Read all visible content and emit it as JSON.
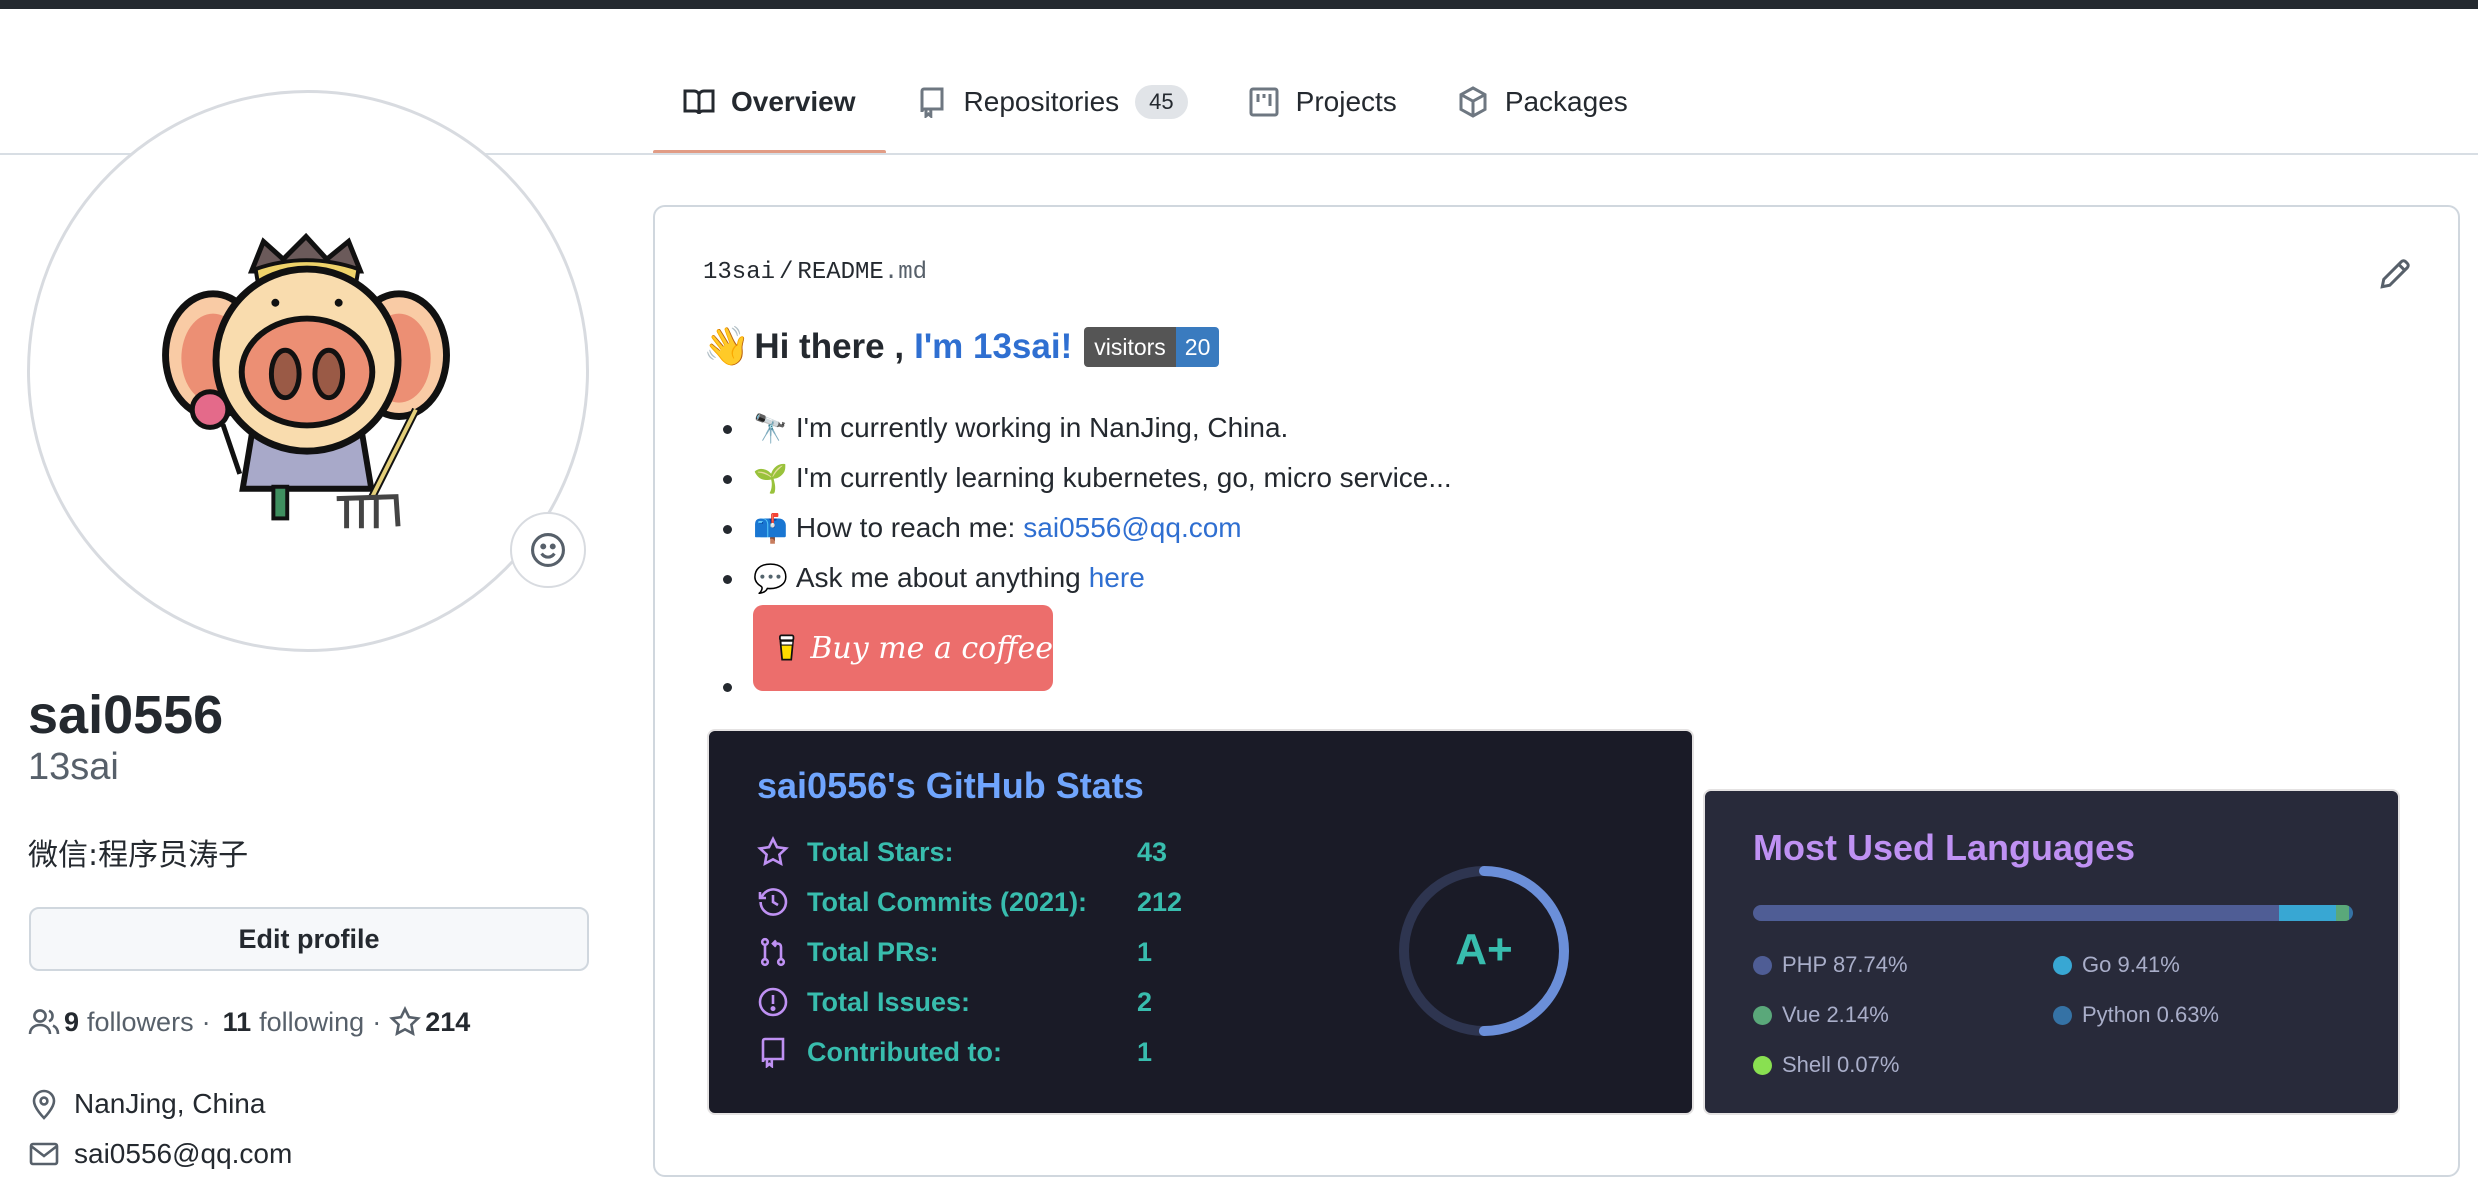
{
  "tabs": [
    {
      "label": "Overview",
      "icon": "book-icon",
      "active": true
    },
    {
      "label": "Repositories",
      "icon": "repo-icon",
      "count": "45"
    },
    {
      "label": "Projects",
      "icon": "project-icon"
    },
    {
      "label": "Packages",
      "icon": "package-icon"
    }
  ],
  "profile": {
    "login": "sai0556",
    "name": "13sai",
    "bio": "微信:程序员涛子",
    "edit_label": "Edit profile",
    "followers_count": "9",
    "followers_label": "followers",
    "following_count": "11",
    "following_label": "following",
    "stars_count": "214",
    "separator": "·",
    "location": "NanJing, China",
    "email": "sai0556@qq.com"
  },
  "readme": {
    "path_owner": "13sai",
    "path_sep": "/",
    "path_file": "README",
    "path_ext": ".md",
    "heading_emoji": "👋",
    "heading_text": "Hi there ,",
    "heading_link": "I'm 13sai!",
    "badge_label": "visitors",
    "badge_value": "20",
    "items": [
      {
        "emoji": "🔭",
        "text": "I'm currently working in NanJing, China."
      },
      {
        "emoji": "🌱",
        "text": "I'm currently learning kubernetes, go, micro service..."
      },
      {
        "emoji": "📫",
        "text": "How to reach me:",
        "link": "sai0556@qq.com"
      },
      {
        "emoji": "💬",
        "text": "Ask me about anything",
        "link": "here"
      }
    ],
    "coffee_label": "Buy me a coffee"
  },
  "stats_card": {
    "title": "sai0556's GitHub Stats",
    "rows": [
      {
        "icon": "star-icon",
        "label": "Total Stars:",
        "value": "43"
      },
      {
        "icon": "history-icon",
        "label": "Total Commits (2021):",
        "value": "212"
      },
      {
        "icon": "pull-request-icon",
        "label": "Total PRs:",
        "value": "1"
      },
      {
        "icon": "issue-icon",
        "label": "Total Issues:",
        "value": "2"
      },
      {
        "icon": "repo-icon",
        "label": "Contributed to:",
        "value": "1"
      }
    ],
    "rank": "A+",
    "rank_progress": 0.5
  },
  "lang_card": {
    "title": "Most Used Languages",
    "languages": [
      {
        "name": "PHP",
        "percent": 87.74,
        "label": "PHP 87.74%",
        "color": "#4f5d95"
      },
      {
        "name": "Go",
        "percent": 9.41,
        "label": "Go 9.41%",
        "color": "#38a7d3"
      },
      {
        "name": "Vue",
        "percent": 2.14,
        "label": "Vue 2.14%",
        "color": "#5aa87a"
      },
      {
        "name": "Python",
        "percent": 0.63,
        "label": "Python 0.63%",
        "color": "#3572a5"
      },
      {
        "name": "Shell",
        "percent": 0.07,
        "label": "Shell 0.07%",
        "color": "#89e051"
      }
    ]
  },
  "colors": {
    "tab_underline": "#e19c85",
    "link": "#2f6fd1",
    "stats_title": "#70a5fd",
    "stats_text": "#38bdae",
    "stats_icon": "#bf91f3",
    "lang_title": "#bf91f3"
  }
}
